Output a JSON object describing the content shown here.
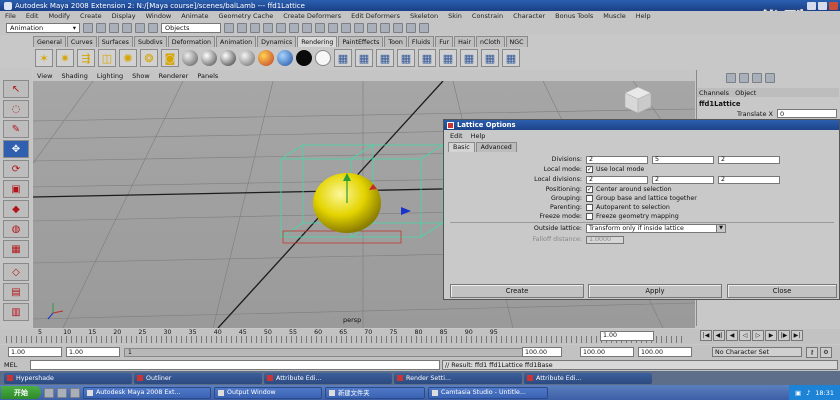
{
  "window": {
    "title": "Autodesk Maya 2008 Extension 2: N:/[Maya course]/scenes/balLamb  ---  ffd1Lattice",
    "watermark": "优酷"
  },
  "menubar": [
    "File",
    "Edit",
    "Modify",
    "Create",
    "Display",
    "Window",
    "Animate",
    "Geometry Cache",
    "Create Deformers",
    "Edit Deformers",
    "Skeleton",
    "Skin",
    "Constrain",
    "Character",
    "Bonus Tools",
    "Muscle",
    "Help"
  ],
  "statusline": {
    "menuset": "Animation",
    "selection_field": "Objects"
  },
  "shelf_tabs": [
    "General",
    "Curves",
    "Surfaces",
    "Subdivs",
    "Deformation",
    "Animation",
    "Dynamics",
    "Rendering",
    "PaintEffects",
    "Toon",
    "Fluids",
    "Fur",
    "Hair",
    "nCloth",
    "NGC"
  ],
  "shelf_active": "Rendering",
  "shelf_icons": [
    "spot-light-icon",
    "point-light-icon",
    "directional-light-icon",
    "area-light-icon",
    "ambient-light-icon",
    "volume-light-icon",
    "camera-icon",
    "lambert-ball-icon",
    "blinn-ball-icon",
    "phong-ball-icon",
    "anisotropic-ball-icon",
    "ramp-ball-icon",
    "layered-ball-icon",
    "black-ball-icon",
    "white-ball-icon",
    "render-settings-icon",
    "render-view-icon",
    "ipr-icon",
    "hypershade-icon",
    "texture-view-icon",
    "light-link-icon",
    "render-layer-icon",
    "render-icon",
    "batch-render-icon"
  ],
  "panel_menu": [
    "View",
    "Shading",
    "Lighting",
    "Show",
    "Renderer",
    "Panels"
  ],
  "viewport": {
    "camera_label": "persp"
  },
  "channel_box": {
    "tabs": [
      "Channels",
      "Object"
    ],
    "node_name": "ffd1Lattice",
    "attr_label": "Translate X",
    "attr_value": "0"
  },
  "lattice_dialog": {
    "title": "Lattice Options",
    "menu": [
      "Edit",
      "Help"
    ],
    "tabs": [
      "Basic",
      "Advanced"
    ],
    "divisions_label": "Divisions:",
    "divisions": [
      "2",
      "5",
      "2"
    ],
    "local_mode_label": "Local mode:",
    "local_mode_text": "Use local mode",
    "local_divisions_label": "Local divisions:",
    "local_divisions": [
      "2",
      "2",
      "2"
    ],
    "positioning_label": "Positioning:",
    "positioning_text": "Center around selection",
    "grouping_label": "Grouping:",
    "grouping_text": "Group base and lattice together",
    "parenting_label": "Parenting:",
    "parenting_text": "Autoparent to selection",
    "freeze_label": "Freeze mode:",
    "freeze_text": "Freeze geometry mapping",
    "outside_label": "Outside lattice:",
    "outside_value": "Transform only if inside lattice",
    "falloff_label": "Falloff distance:",
    "falloff_value": "1.0000",
    "buttons": [
      "Create",
      "Apply",
      "Close"
    ]
  },
  "timeline": {
    "ticks": [
      "5",
      "10",
      "15",
      "20",
      "25",
      "30",
      "35",
      "40",
      "45",
      "50",
      "55",
      "60",
      "65",
      "70",
      "75",
      "80",
      "85",
      "90",
      "95"
    ],
    "current_frame": "1.00"
  },
  "range": {
    "start": "1.00",
    "playback_start": "1.00",
    "current_marker": "1",
    "end_a": "100.00",
    "end_b": "100.00",
    "end_c": "100.00",
    "character": "No Character Set"
  },
  "command": {
    "label": "MEL",
    "result": "// Result: ffd1 ffd1Lattice ffd1Base"
  },
  "min_windows": [
    "Hypershade",
    "Outliner",
    "Attribute Edi...",
    "Render Setti...",
    "Attribute Edi..."
  ],
  "taskbar": {
    "start": "开始",
    "tasks": [
      "Autodesk Maya 2008 Ext...",
      "Output Window",
      "新建文件夹",
      "Camtasia Studio - Untitle..."
    ],
    "clock": "18:31"
  }
}
